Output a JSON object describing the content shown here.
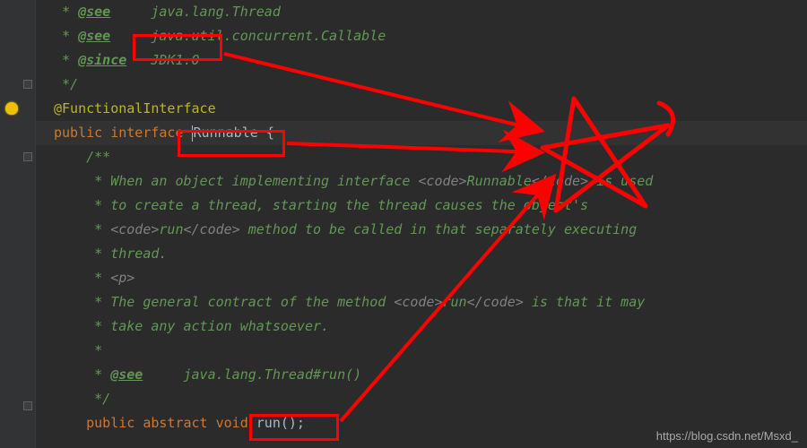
{
  "javadoc": {
    "see_tag": "@see",
    "see1_val": "java.lang.Thread",
    "see2_val": "java.util.concurrent.Callable",
    "since_tag": "@since",
    "since_val": "JDK1.0",
    "close": "*/"
  },
  "annotation": "@FunctionalInterface",
  "decl": {
    "kw_public": "public",
    "kw_interface": "interface",
    "name": "Runnable",
    "brace": "{"
  },
  "inner_doc": {
    "open": "/**",
    "l1a": " * When an object implementing interface ",
    "l1b": "<code>",
    "l1c": "Runnable",
    "l1d": "</code>",
    "l1e": " is used",
    "l2": " * to create a thread, starting the thread causes the object's",
    "l3a": " * ",
    "l3b": "<code>",
    "l3c": "run",
    "l3d": "</code>",
    "l3e": " method to be called in that separately executing",
    "l4": " * thread.",
    "l5a": " * ",
    "l5b": "<p>",
    "l6a": " * The general contract of the method ",
    "l6b": "<code>",
    "l6c": "run",
    "l6d": "</code>",
    "l6e": " is that it may",
    "l7": " * take any action whatsoever.",
    "l8": " *",
    "see_tag": "@see",
    "see_val": "java.lang.Thread#run()",
    "close": " */"
  },
  "method": {
    "kw_public": "public",
    "kw_abstract": "abstract",
    "kw_void": "void",
    "name": "run",
    "tail": "();"
  },
  "watermark": "https://blog.csdn.net/Msxd_",
  "annotations": {
    "box1": "since-highlight",
    "box2": "classname-highlight",
    "box3": "method-highlight",
    "star": "star-scribble",
    "arrows": "pointer-arrows"
  }
}
